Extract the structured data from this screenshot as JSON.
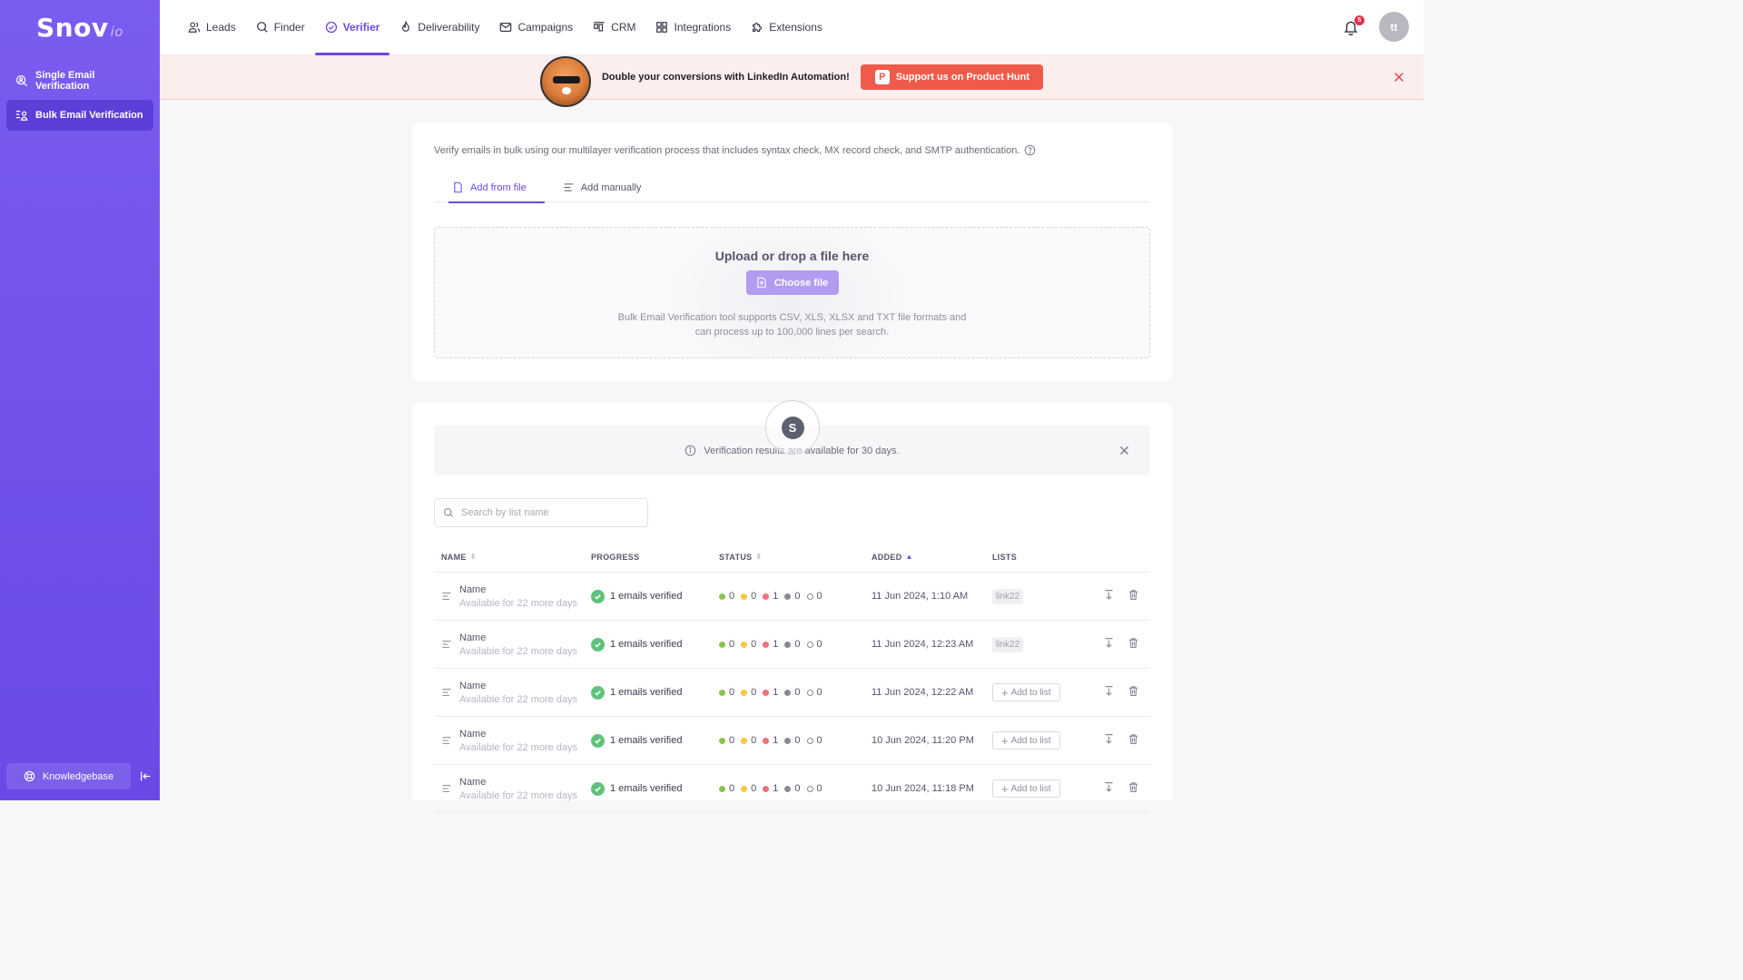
{
  "app": {
    "logo_main": "Snov",
    "logo_suffix": "io"
  },
  "sidebar": {
    "items": [
      {
        "label": "Single Email Verification",
        "icon": "search-user-icon",
        "active": false
      },
      {
        "label": "Bulk Email Verification",
        "icon": "list-user-icon",
        "active": true
      }
    ],
    "knowledgebase": "Knowledgebase"
  },
  "nav": {
    "items": [
      {
        "label": "Leads",
        "icon": "users-icon"
      },
      {
        "label": "Finder",
        "icon": "search-icon"
      },
      {
        "label": "Verifier",
        "icon": "check-circle-icon",
        "active": true
      },
      {
        "label": "Deliverability",
        "icon": "flame-icon"
      },
      {
        "label": "Campaigns",
        "icon": "mail-icon"
      },
      {
        "label": "CRM",
        "icon": "kanban-icon"
      },
      {
        "label": "Integrations",
        "icon": "grid-icon"
      },
      {
        "label": "Extensions",
        "icon": "puzzle-icon"
      }
    ],
    "notification_count": "5",
    "avatar_initials": "tt"
  },
  "banner": {
    "text": "Double your conversions with LinkedIn Automation!",
    "button_label": "Support us on Product Hunt",
    "button_logo": "P"
  },
  "upload": {
    "intro": "Verify emails in bulk using our multilayer verification process that includes syntax check, MX record check, and SMTP authentication.",
    "tabs": [
      "Add from file",
      "Add manually"
    ],
    "title": "Upload or drop a file here",
    "choose_label": "Choose file",
    "description": "Bulk Email Verification tool supports CSV, XLS, XLSX and TXT file formats and can process up to 100,000 lines per search."
  },
  "results": {
    "loader_letter": "S",
    "info_text": "Verification results are available for 30 days.",
    "search_placeholder": "Search by list name",
    "columns": [
      "NAME",
      "PROGRESS",
      "STATUS",
      "ADDED",
      "LISTS"
    ],
    "status_colors": [
      "#8bc34a",
      "#f5c842",
      "#f0707a",
      "#8a8a96"
    ],
    "rows": [
      {
        "name": "Name",
        "sub": "Available for 22 more days",
        "progress": "1 emails verified",
        "status": [
          "0",
          "0",
          "1",
          "0",
          "0"
        ],
        "added": "11 Jun 2024, 1:10 AM",
        "list": "link22"
      },
      {
        "name": "Name",
        "sub": "Available for 22 more days",
        "progress": "1 emails verified",
        "status": [
          "0",
          "0",
          "1",
          "0",
          "0"
        ],
        "added": "11 Jun 2024, 12:23 AM",
        "list": "link22"
      },
      {
        "name": "Name",
        "sub": "Available for 22 more days",
        "progress": "1 emails verified",
        "status": [
          "0",
          "0",
          "1",
          "0",
          "0"
        ],
        "added": "11 Jun 2024, 12:22 AM",
        "list": "Add to list"
      },
      {
        "name": "Name",
        "sub": "Available for 22 more days",
        "progress": "1 emails verified",
        "status": [
          "0",
          "0",
          "1",
          "0",
          "0"
        ],
        "added": "10 Jun 2024, 11:20 PM",
        "list": "Add to list"
      },
      {
        "name": "Name",
        "sub": "Available for 22 more days",
        "progress": "1 emails verified",
        "status": [
          "0",
          "0",
          "1",
          "0",
          "0"
        ],
        "added": "10 Jun 2024, 11:18 PM",
        "list": "Add to list"
      }
    ]
  }
}
